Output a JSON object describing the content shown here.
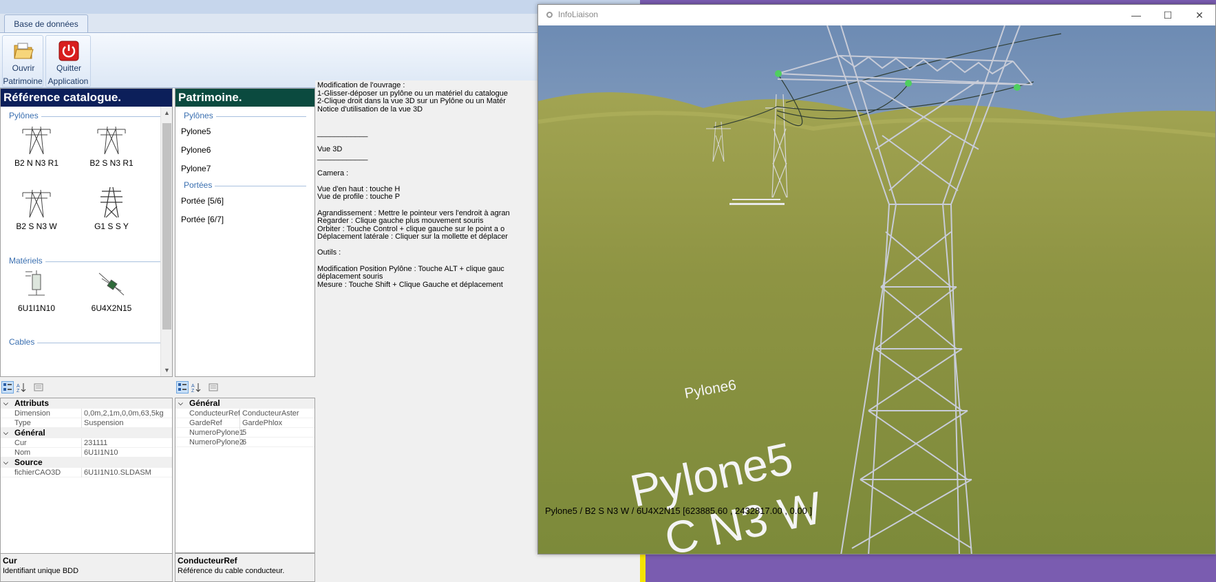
{
  "ribbon": {
    "tab_label": "Base de données",
    "open": {
      "label": "Ouvrir",
      "group": "Patrimoine"
    },
    "quit": {
      "label": "Quitter",
      "group": "Application"
    }
  },
  "catalog": {
    "header": "Référence catalogue.",
    "sections": {
      "pylones": "Pylônes",
      "materiels": "Matériels",
      "cables": "Cables"
    },
    "pylones": [
      "B2 N N3 R1",
      "B2 S N3 R1",
      "B2 S N3 W",
      "G1 S S Y"
    ],
    "materiels": [
      "6U1I1N10",
      "6U4X2N15"
    ]
  },
  "patrimoine": {
    "header": "Patrimoine.",
    "sections": {
      "pylones": "Pylônes",
      "portees": "Portées"
    },
    "pylones": [
      "Pylone5",
      "Pylone6",
      "Pylone7"
    ],
    "portees": [
      "Portée [5/6]",
      "Portée [6/7]"
    ]
  },
  "props_left": {
    "categories": [
      {
        "name": "Attributs",
        "rows": [
          {
            "key": "Dimension",
            "value": "0,0m,2,1m,0,0m,63,5kg"
          },
          {
            "key": "Type",
            "value": "Suspension"
          }
        ]
      },
      {
        "name": "Général",
        "rows": [
          {
            "key": "Cur",
            "value": "231111"
          },
          {
            "key": "Nom",
            "value": "6U1I1N10"
          }
        ]
      },
      {
        "name": "Source",
        "rows": [
          {
            "key": "fichierCAO3D",
            "value": "6U1I1N10.SLDASM"
          }
        ]
      }
    ],
    "desc_title": "Cur",
    "desc_text": "Identifiant unique BDD"
  },
  "props_right": {
    "categories": [
      {
        "name": "Général",
        "rows": [
          {
            "key": "ConducteurRef",
            "value": "ConducteurAster"
          },
          {
            "key": "GardeRef",
            "value": "GardePhlox"
          },
          {
            "key": "NumeroPylone1",
            "value": "5"
          },
          {
            "key": "NumeroPylone2",
            "value": "6"
          }
        ]
      }
    ],
    "desc_title": "ConducteurRef",
    "desc_text": "Référence du cable conducteur."
  },
  "notice_text": "Modification de l'ouvrage :\n1-Glisser-déposer un pylône ou un matériel du catalogue\n2-Clique droit dans la vue 3D sur un Pylône ou un Matér\nNotice d'utilisation de la vue 3D\n\n\n____________\n\nVue 3D\n____________\n\nCamera :\n\nVue d'en haut : touche H\nVue de profile : touche P\n\nAgrandissement : Mettre le pointeur vers l'endroit à agran\nRegarder : Clique gauche plus mouvement souris\nOrbiter : Touche Control + clique gauche sur le point a o\nDéplacement latérale : Cliquer sur la mollette et déplacer\n\nOutils :\n\nModification Position Pylône : Touche ALT + clique gauc\ndéplacement souris\nMesure : Touche Shift + Clique Gauche et déplacement",
  "window3d": {
    "title": "InfoLiaison",
    "label_pylone6": "Pylone6",
    "label_pylone5": "Pylone5",
    "label_type": "C N3 W",
    "status": "Pylone5 / B2 S N3 W / 6U4X2N15 [623885.60 , 2432817.00 , 0.00 ]"
  },
  "colors": {
    "catalog_header": "#0c1f5a",
    "patrimoine_header": "#0b4a3f",
    "ground": "#8f9545",
    "sky": "#7f9bbf",
    "accent": "#3a6fb0"
  }
}
